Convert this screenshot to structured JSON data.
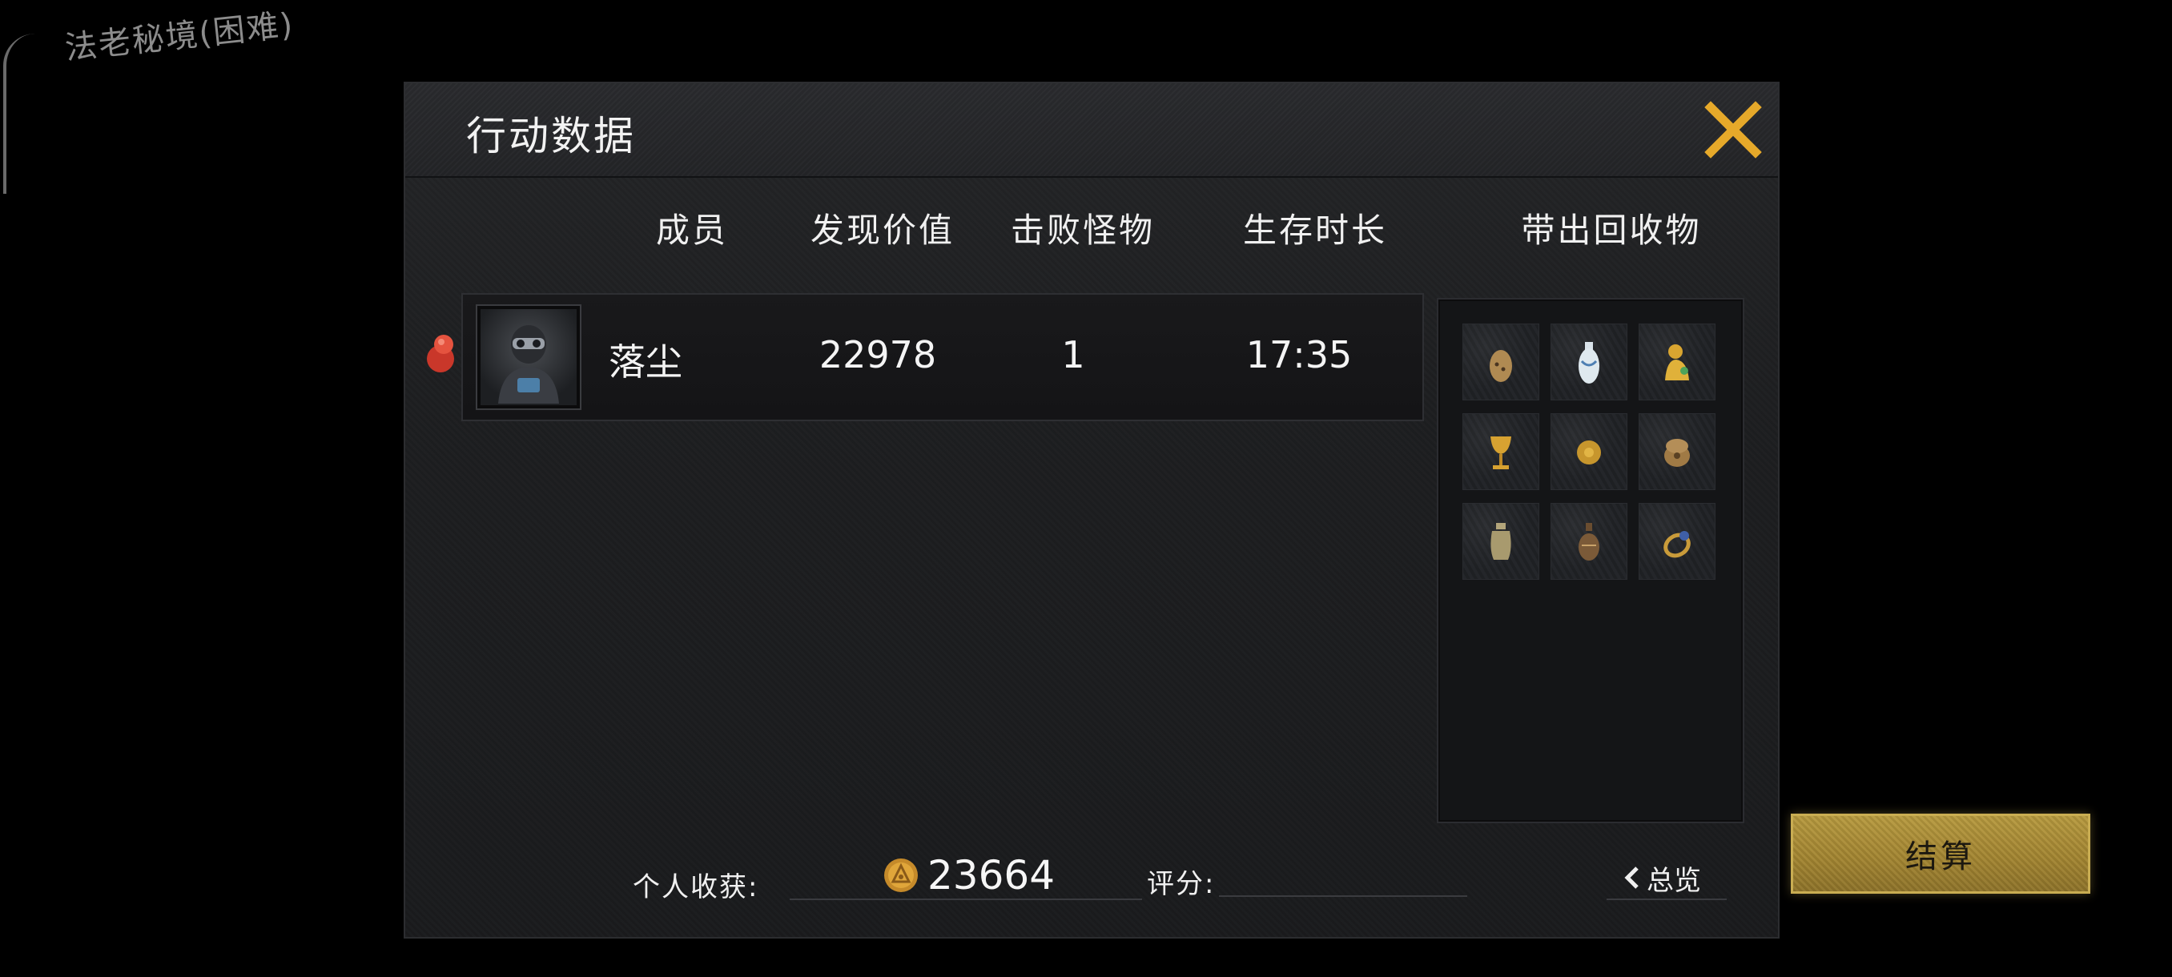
{
  "map": {
    "label": "法老秘境(困难)"
  },
  "panel": {
    "title": "行动数据"
  },
  "columns": {
    "member": "成员",
    "value": "发现价值",
    "kills": "击败怪物",
    "survival": "生存时长",
    "loot": "带出回收物"
  },
  "member": {
    "name": "落尘",
    "value": "22978",
    "kills": "1",
    "survival": "17:35"
  },
  "loot_items": [
    {
      "icon": "ocarina-icon"
    },
    {
      "icon": "porcelain-vase-icon"
    },
    {
      "icon": "golden-figurine-icon"
    },
    {
      "icon": "golden-goblet-icon"
    },
    {
      "icon": "golden-orb-icon"
    },
    {
      "icon": "compass-icon"
    },
    {
      "icon": "clay-jar-icon"
    },
    {
      "icon": "bronze-flask-icon"
    },
    {
      "icon": "sapphire-ring-icon"
    }
  ],
  "footer": {
    "income_label": "个人收获:",
    "income_value": "23664",
    "rating_label": "评分:",
    "overview_label": "总览"
  },
  "settle": {
    "label": "结算"
  },
  "colors": {
    "accent_gold": "#e6a92a",
    "settle_gold": "#a48632",
    "pin_red": "#d9412f"
  }
}
